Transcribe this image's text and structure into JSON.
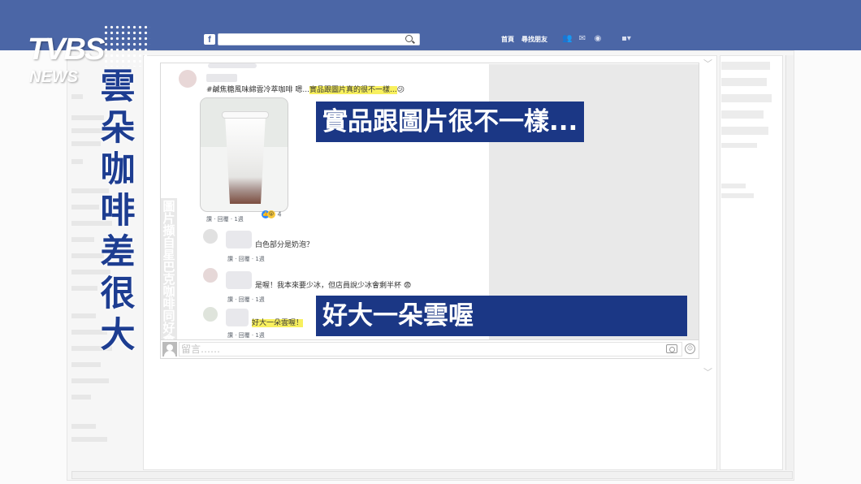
{
  "topbar": {
    "search_placeholder": "",
    "nav_home": "首頁",
    "nav_find_friends": "尋找朋友"
  },
  "brand": {
    "logo_main": "TVBS",
    "logo_sub": "NEWS"
  },
  "headline": [
    "雲",
    "朵",
    "咖",
    "啡",
    "差",
    "很",
    "大"
  ],
  "side_caption": [
    "圖",
    "片",
    "擷",
    "自",
    "星",
    "巴",
    "克",
    "咖",
    "啡",
    "同",
    "好",
    "會"
  ],
  "post": {
    "text_plain": "#鹹焦糖風味綿雲冷萃咖啡 嗯...",
    "text_highlight": "實品跟圖片真的很不一樣...",
    "meta": "讚 · 回覆 · 1週",
    "reaction_count": "4"
  },
  "comments": [
    {
      "text": "白色部分是奶泡？",
      "meta": "讚 · 回覆 · 1週"
    },
    {
      "text": "是喔！我本來要少冰，但店員說少冰會剩半杯 😨",
      "meta": "讚 · 回覆 · 1週"
    },
    {
      "text": "好大一朵雲喔！",
      "meta": "讚 · 回覆 · 1週"
    }
  ],
  "overlay": {
    "title1": "實品跟圖片很不一樣...",
    "title2": "好大一朵雲喔"
  },
  "comment_box": {
    "placeholder": "留言……"
  },
  "colors": {
    "facebook_blue": "#4b66a6",
    "headline_blue": "#1d3d91",
    "overlay_blue": "#1b3785",
    "highlight_yellow": "#f8f05e"
  }
}
